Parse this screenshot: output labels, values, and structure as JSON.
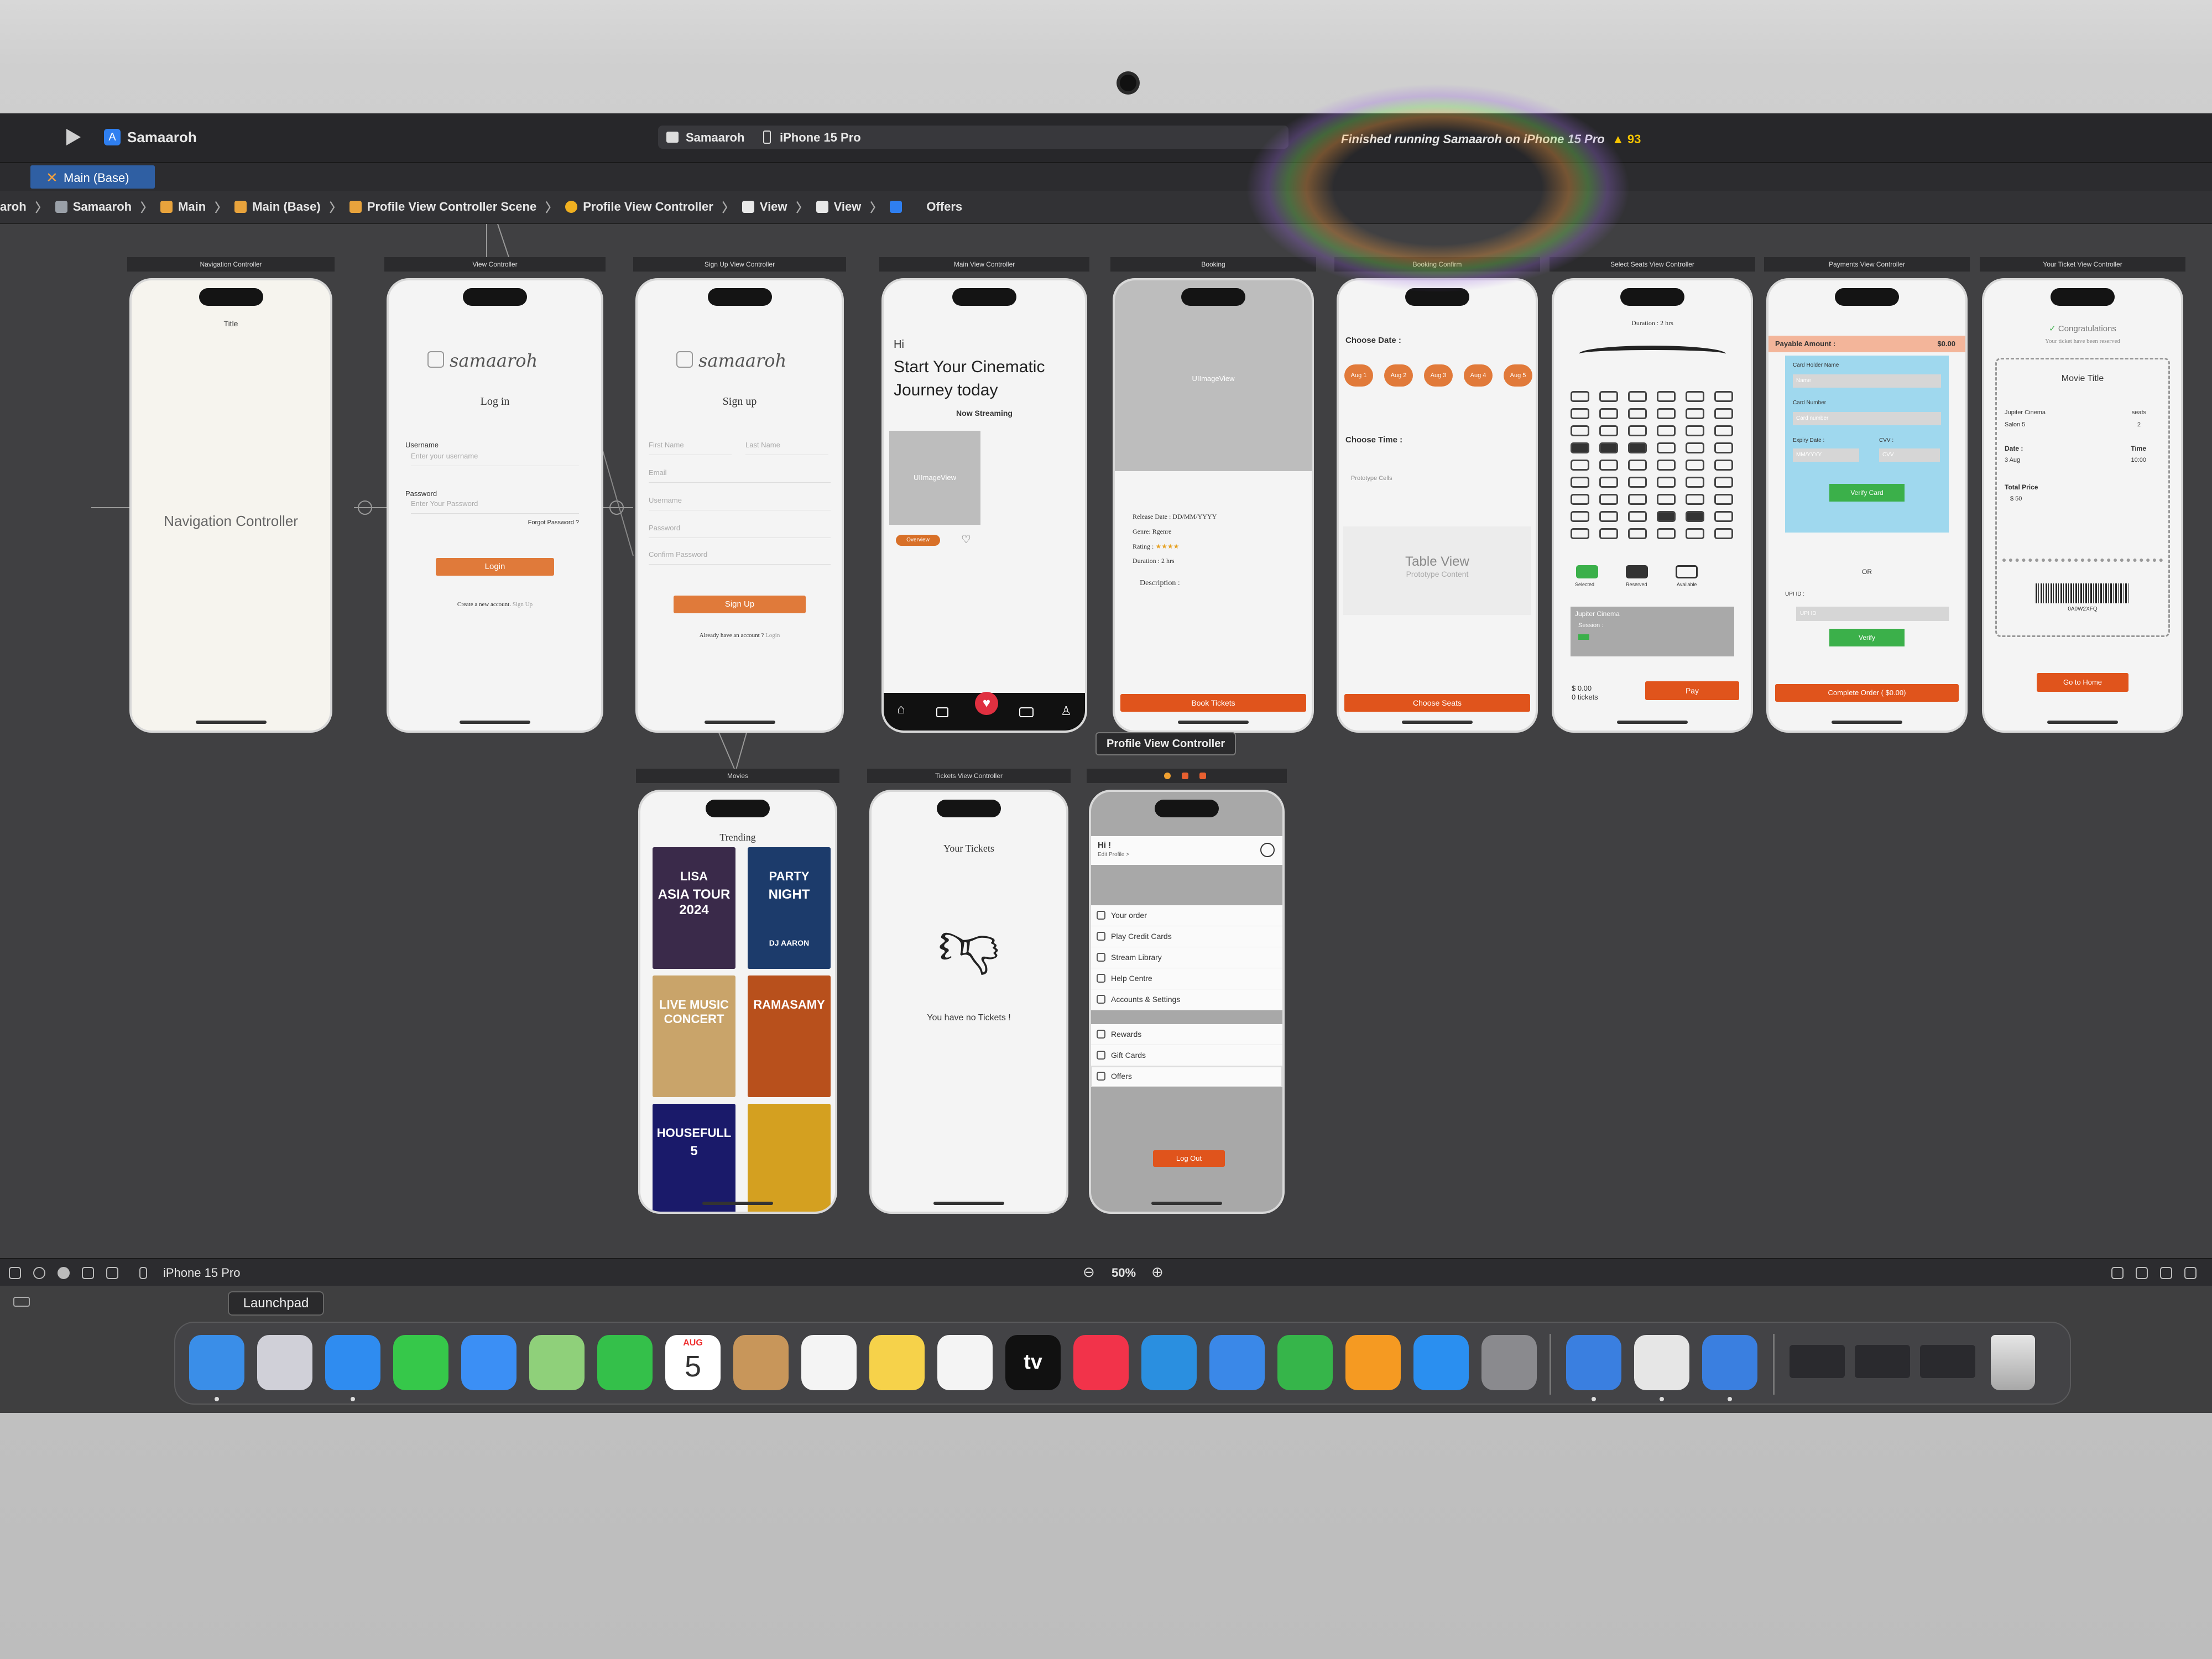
{
  "toolbar": {
    "app_name": "Samaaroh",
    "scheme": "Samaaroh",
    "device": "iPhone 15 Pro",
    "status": "Finished running Samaaroh on iPhone 15 Pro",
    "warnings": "93"
  },
  "tab": {
    "label": "Main (Base)"
  },
  "breadcrumbs": [
    "aroh",
    "Samaaroh",
    "Main",
    "Main (Base)",
    "Profile View Controller Scene",
    "Profile View Controller",
    "View",
    "View",
    "",
    "Offers"
  ],
  "scenes": {
    "nav": {
      "title": "Navigation Controller",
      "nav_title": "Title",
      "body": "Navigation Controller"
    },
    "login": {
      "title": "View Controller",
      "logo": "samaaroh",
      "heading": "Log in",
      "username_label": "Username",
      "username_ph": "Enter your username",
      "password_label": "Password",
      "password_ph": "Enter Your Password",
      "forgot": "Forgot Password ?",
      "button": "Login",
      "footer": "Create a new account.",
      "footer_link": "Sign Up"
    },
    "signup": {
      "title": "Sign Up View Controller",
      "logo": "samaaroh",
      "heading": "Sign up",
      "first": "First Name",
      "last": "Last Name",
      "email": "Email",
      "username": "Username",
      "password": "Password",
      "confirm": "Confirm Password",
      "button": "Sign Up",
      "footer": "Already have an account ?",
      "footer_link": "Login"
    },
    "main": {
      "title": "Main View Controller",
      "hi": "Hi",
      "headline1": "Start Your Cinematic",
      "headline2": "Journey today",
      "sub": "Now Streaming",
      "image_label": "UIImageView",
      "btn": "Overview"
    },
    "booking": {
      "title": "Booking",
      "image_label": "UIImageView",
      "release": "Release Date : DD/MM/YYYY",
      "genre": "Genre: Rgenre",
      "rating": "Rating :",
      "stars": "★★★★",
      "duration": "Duration :  2 hrs",
      "description": "Description :",
      "button": "Book Tickets"
    },
    "confirm": {
      "title": "Booking Confirm",
      "choose_date": "Choose Date :",
      "dates": [
        "Aug 1",
        "Aug 2",
        "Aug 3",
        "Aug 4",
        "Aug 5"
      ],
      "choose_time": "Choose Time :",
      "proto": "Prototype Cells",
      "table": "Table View",
      "table_sub": "Prototype Content",
      "button": "Choose Seats"
    },
    "seats": {
      "title": "Select Seats View Controller",
      "duration": "Duration : 2 hrs",
      "legend": [
        "Selected",
        "Reserved",
        "Available"
      ],
      "cinema": "Jupiter Cinema",
      "session": "Session :",
      "price": "$ 0.00",
      "tickets": "0 tickets",
      "button": "Pay"
    },
    "payment": {
      "title": "Payments View Controller",
      "payable": "Payable Amount :",
      "amount": "$0.00",
      "holder": "Card Holder Name",
      "holder_ph": "Name",
      "number": "Card Number",
      "number_ph": "Card number",
      "expiry": "Expiry Date :",
      "expiry_ph": "MM/YYYY",
      "cvv": "CVV :",
      "cvv_ph": "CVV",
      "verify_card": "Verify Card",
      "or": "OR",
      "upi": "UPI ID :",
      "upi_ph": "UPI ID",
      "verify": "Verify",
      "button": "Complete Order ( $0.00)"
    },
    "ticket": {
      "title": "Your Ticket View Controller",
      "congrats": "Congratulations",
      "reserved": "Your ticket have been reserved",
      "movie": "Movie Title",
      "cinema": "Jupiter Cinema",
      "salon": "Salon 5",
      "seats_label": "seats",
      "seats_val": "2",
      "date_label": "Date :",
      "date_val": "3 Aug",
      "time_label": "Time",
      "time_val": "10:00",
      "total_label": "Total Price",
      "total_val": "$ 50",
      "code": "0A0W2XFQ",
      "button": "Go to Home"
    },
    "movies": {
      "title": "Movies",
      "heading": "Trending",
      "posters": [
        {
          "line1": "LISA",
          "line2": "ASIA TOUR 2024",
          "bg": "#3a2a4a"
        },
        {
          "line1": "PARTY",
          "line2": "NIGHT",
          "line3": "DJ AARON",
          "bg": "#1c3b6b"
        },
        {
          "line1": "LIVE MUSIC CONCERT",
          "line2": "",
          "bg": "#c9a46a"
        },
        {
          "line1": "RAMASAMY",
          "line2": "",
          "bg": "#b8501c"
        },
        {
          "line1": "HOUSEFULL",
          "line2": "5",
          "bg": "#1a1a6a"
        },
        {
          "line1": "",
          "line2": "",
          "bg": "#d4a020"
        }
      ]
    },
    "tickets": {
      "title": "Tickets View Controller",
      "heading": "Your Tickets",
      "empty": "You have no Tickets !"
    },
    "profile": {
      "title": "Profile View Controller",
      "hi": "Hi !",
      "edit": "Edit Profile >",
      "menu1": [
        "Your order",
        "Play Credit Cards",
        "Stream Library",
        "Help Centre",
        "Accounts & Settings"
      ],
      "menu2": [
        "Rewards",
        "Gift Cards",
        "Offers"
      ],
      "logout": "Log Out"
    }
  },
  "bottombar": {
    "device": "iPhone 15 Pro",
    "zoom": "50%"
  },
  "tooltip": "Launchpad",
  "dock": {
    "apps": [
      {
        "name": "Finder",
        "color": "#3a8ee8"
      },
      {
        "name": "Launchpad",
        "color": "#d0d0d8"
      },
      {
        "name": "Safari",
        "color": "#2f8cf0"
      },
      {
        "name": "Messages",
        "color": "#36c84a"
      },
      {
        "name": "Mail",
        "color": "#3b8ff5"
      },
      {
        "name": "Maps",
        "color": "#8fd07a"
      },
      {
        "name": "FaceTime",
        "color": "#34c04a"
      },
      {
        "name": "Calendar",
        "color": "#ffffff"
      },
      {
        "name": "Contacts",
        "color": "#c8965a"
      },
      {
        "name": "Reminders",
        "color": "#f4f4f4"
      },
      {
        "name": "Notes",
        "color": "#f6d24a"
      },
      {
        "name": "Freeform",
        "color": "#f4f4f4"
      },
      {
        "name": "TV",
        "color": "#111111"
      },
      {
        "name": "Music",
        "color": "#f2334a"
      },
      {
        "name": "Keynote",
        "color": "#2a8fe0"
      },
      {
        "name": "Weather",
        "color": "#3a88e8"
      },
      {
        "name": "Numbers",
        "color": "#36b54a"
      },
      {
        "name": "Pages",
        "color": "#f59a22"
      },
      {
        "name": "App Store",
        "color": "#2a8ff0"
      },
      {
        "name": "System Settings",
        "color": "#8a8a8e"
      },
      {
        "name": "Xcode",
        "color": "#3a7fe0"
      },
      {
        "name": "Preview",
        "color": "#e6e6e6"
      },
      {
        "name": "Simulator",
        "color": "#3a7fe0"
      }
    ],
    "calendar_month": "AUG",
    "calendar_day": "5",
    "tv_label": "tv"
  }
}
